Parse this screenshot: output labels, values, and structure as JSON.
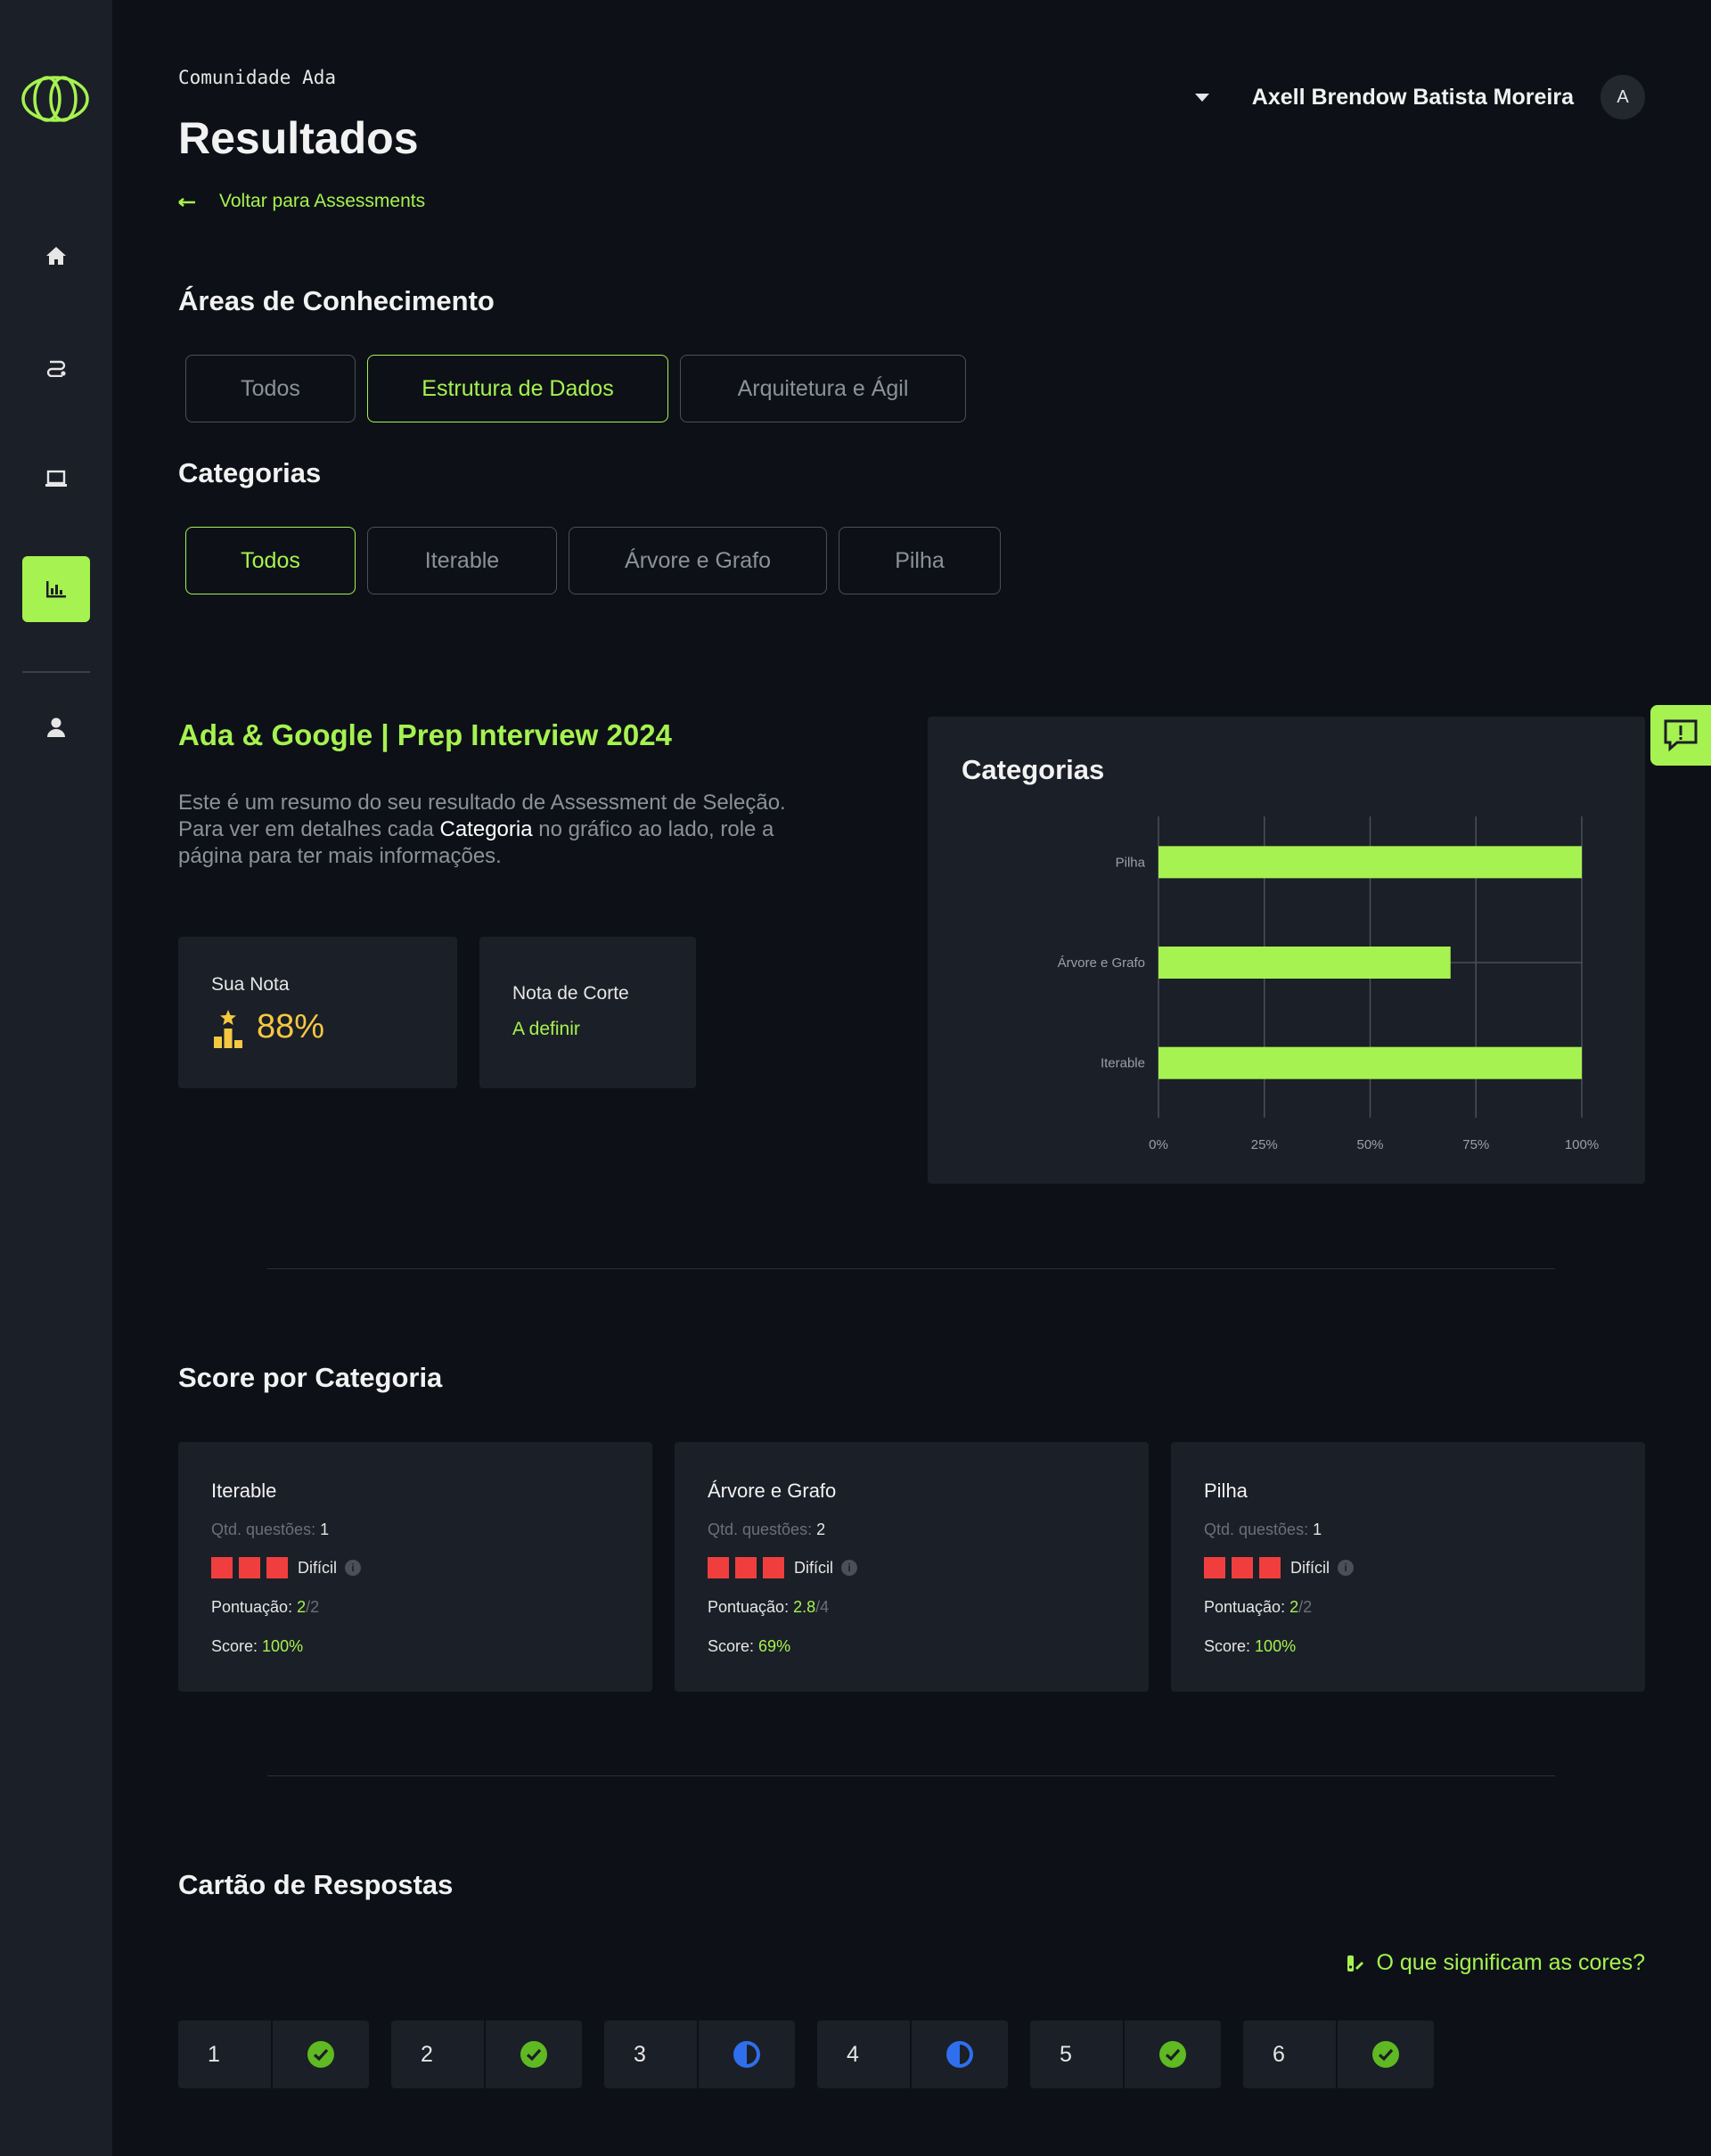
{
  "header": {
    "org": "Comunidade Ada",
    "title": "Resultados",
    "back_label": "Voltar para Assessments",
    "user_name": "Axell Brendow Batista Moreira",
    "avatar_initial": "A"
  },
  "sidebar": {
    "items": [
      {
        "name": "home",
        "icon": "home-icon"
      },
      {
        "name": "trail",
        "icon": "route-icon"
      },
      {
        "name": "courses",
        "icon": "laptop-icon"
      },
      {
        "name": "results",
        "icon": "bar-chart-icon",
        "active": true
      },
      {
        "name": "profile",
        "icon": "user-icon"
      }
    ]
  },
  "areas": {
    "title": "Áreas de Conhecimento",
    "chips": [
      {
        "label": "Todos",
        "active": false
      },
      {
        "label": "Estrutura de Dados",
        "active": true
      },
      {
        "label": "Arquitetura e Ágil",
        "active": false
      }
    ]
  },
  "categories": {
    "title": "Categorias",
    "chips": [
      {
        "label": "Todos",
        "active": true
      },
      {
        "label": "Iterable",
        "active": false
      },
      {
        "label": "Árvore e Grafo",
        "active": false
      },
      {
        "label": "Pilha",
        "active": false
      }
    ]
  },
  "assessment": {
    "title": "Ada & Google | Prep Interview 2024",
    "desc_1": "Este é um resumo do seu resultado de Assessment de Seleção. Para ver em detalhes cada ",
    "desc_hl": "Categoria",
    "desc_2": " no gráfico ao lado, role a página para ter mais informações.",
    "your_grade_label": "Sua Nota",
    "your_grade_value": "88%",
    "cutoff_label": "Nota de Corte",
    "cutoff_value": "A definir"
  },
  "chart_data": {
    "type": "bar",
    "orientation": "horizontal",
    "title": "Categorias",
    "categories": [
      "Pilha",
      "Árvore e Grafo",
      "Iterable"
    ],
    "values": [
      100,
      69,
      100
    ],
    "xlim": [
      0,
      100
    ],
    "xticks": [
      "0%",
      "25%",
      "50%",
      "75%",
      "100%"
    ],
    "grid": true,
    "bar_color": "#a6f250"
  },
  "score": {
    "title": "Score por Categoria",
    "qtd_label": "Qtd. questões:",
    "difficulty_label": "Difícil",
    "points_label": "Pontuação:",
    "score_label": "Score:",
    "cards": [
      {
        "name": "Iterable",
        "qtd": "1",
        "points": "2",
        "points_total": "/2",
        "score": "100%"
      },
      {
        "name": "Árvore e Grafo",
        "qtd": "2",
        "points": "2.8",
        "points_total": "/4",
        "score": "69%"
      },
      {
        "name": "Pilha",
        "qtd": "1",
        "points": "2",
        "points_total": "/2",
        "score": "100%"
      }
    ]
  },
  "answers": {
    "title": "Cartão de Respostas",
    "legend_label": "O que significam as cores?",
    "items": [
      {
        "num": "1",
        "status": "correct"
      },
      {
        "num": "2",
        "status": "correct"
      },
      {
        "num": "3",
        "status": "partial"
      },
      {
        "num": "4",
        "status": "partial"
      },
      {
        "num": "5",
        "status": "correct"
      },
      {
        "num": "6",
        "status": "correct"
      }
    ]
  },
  "colors": {
    "accent": "#a6f250",
    "background": "#0d1117",
    "card": "#1b1f27",
    "danger": "#f03e3e",
    "correct": "#5fb922",
    "partial": "#2f6fed",
    "gold": "#f5c842"
  }
}
